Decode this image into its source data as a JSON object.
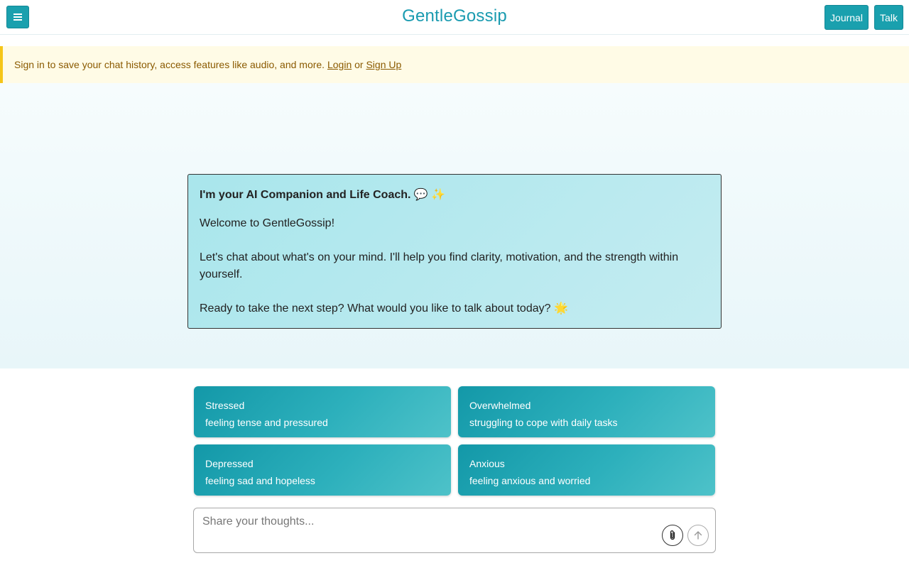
{
  "header": {
    "brand": "GentleGossip",
    "menu_icon": "hamburger-menu-icon",
    "journal_label": "Journal",
    "talk_label": "Talk"
  },
  "banner": {
    "text": "Sign in to save your chat history, access features like audio, and more.",
    "login_label": "Login",
    "or_text": "or",
    "signup_label": "Sign Up"
  },
  "welcome": {
    "title": "I'm your AI Companion and Life Coach. 💬 ✨",
    "line1": "Welcome to GentleGossip!",
    "line2": "Let's chat about what's on your mind. I'll help you find clarity, motivation, and the strength within yourself.",
    "line3": "Ready to take the next step? What would you like to talk about today? 🌟"
  },
  "moods": [
    {
      "title": "Stressed",
      "subtitle": "feeling tense and pressured"
    },
    {
      "title": "Overwhelmed",
      "subtitle": "struggling to cope with daily tasks"
    },
    {
      "title": "Depressed",
      "subtitle": "feeling sad and hopeless"
    },
    {
      "title": "Anxious",
      "subtitle": "feeling anxious and worried"
    }
  ],
  "input": {
    "placeholder": "Share your thoughts...",
    "value": ""
  },
  "colors": {
    "brand": "#1a9bb0",
    "button": "#1aa0ae",
    "banner_bg": "#fffbe6",
    "banner_accent": "#f5c518"
  }
}
